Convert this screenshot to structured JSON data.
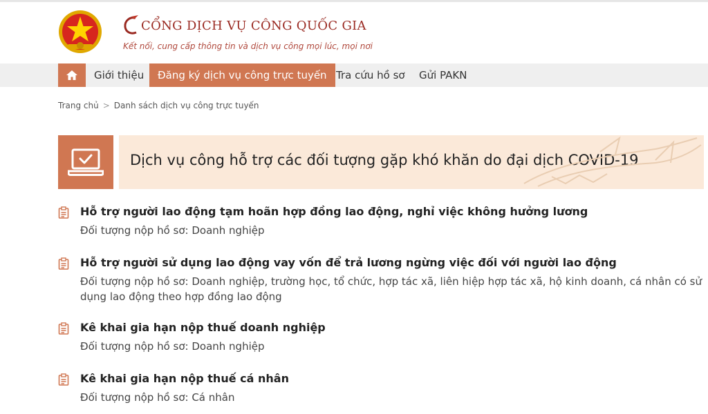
{
  "header": {
    "title": "CỔNG DỊCH VỤ CÔNG QUỐC GIA",
    "tagline": "Kết nối, cung cấp thông tin và dịch vụ công mọi lúc, mọi nơi",
    "emblem_icon": "national-emblem-icon",
    "accent_color": "#d07752",
    "brand_color": "#9a2a22"
  },
  "nav": {
    "home_icon": "home-icon",
    "items": [
      {
        "label": "Giới thiệu",
        "active": false
      },
      {
        "label": "Đăng ký dịch vụ công trực tuyến",
        "active": true
      },
      {
        "label": "Tra cứu hồ sơ",
        "active": false
      },
      {
        "label": "Gửi PAKN",
        "active": false
      }
    ]
  },
  "breadcrumb": {
    "home": "Trang chủ",
    "separator": ">",
    "current": "Danh sách dịch vụ công trực tuyến"
  },
  "category": {
    "icon": "laptop-check-icon",
    "title": "Dịch vụ công hỗ trợ các đối tượng gặp khó khăn do đại dịch COVID-19"
  },
  "services": [
    {
      "icon": "document-icon",
      "title": "Hỗ trợ người lao động tạm hoãn hợp đồng lao động, nghỉ việc không hưởng lương",
      "description": "Đối tượng nộp hồ sơ: Doanh nghiệp"
    },
    {
      "icon": "document-icon",
      "title": "Hỗ trợ người sử dụng lao động vay vốn để trả lương ngừng việc đối với người lao động",
      "description": "Đối tượng nộp hồ sơ: Doanh nghiệp, trường học, tổ chức, hợp tác xã, liên hiệp hợp tác xã, hộ kinh doanh, cá nhân có sử dụng lao động theo hợp đồng lao động"
    },
    {
      "icon": "document-icon",
      "title": "Kê khai gia hạn nộp thuế doanh nghiệp",
      "description": "Đối tượng nộp hồ sơ: Doanh nghiệp"
    },
    {
      "icon": "document-icon",
      "title": "Kê khai gia hạn nộp thuế cá nhân",
      "description": "Đối tượng nộp hồ sơ: Cá nhân"
    }
  ]
}
